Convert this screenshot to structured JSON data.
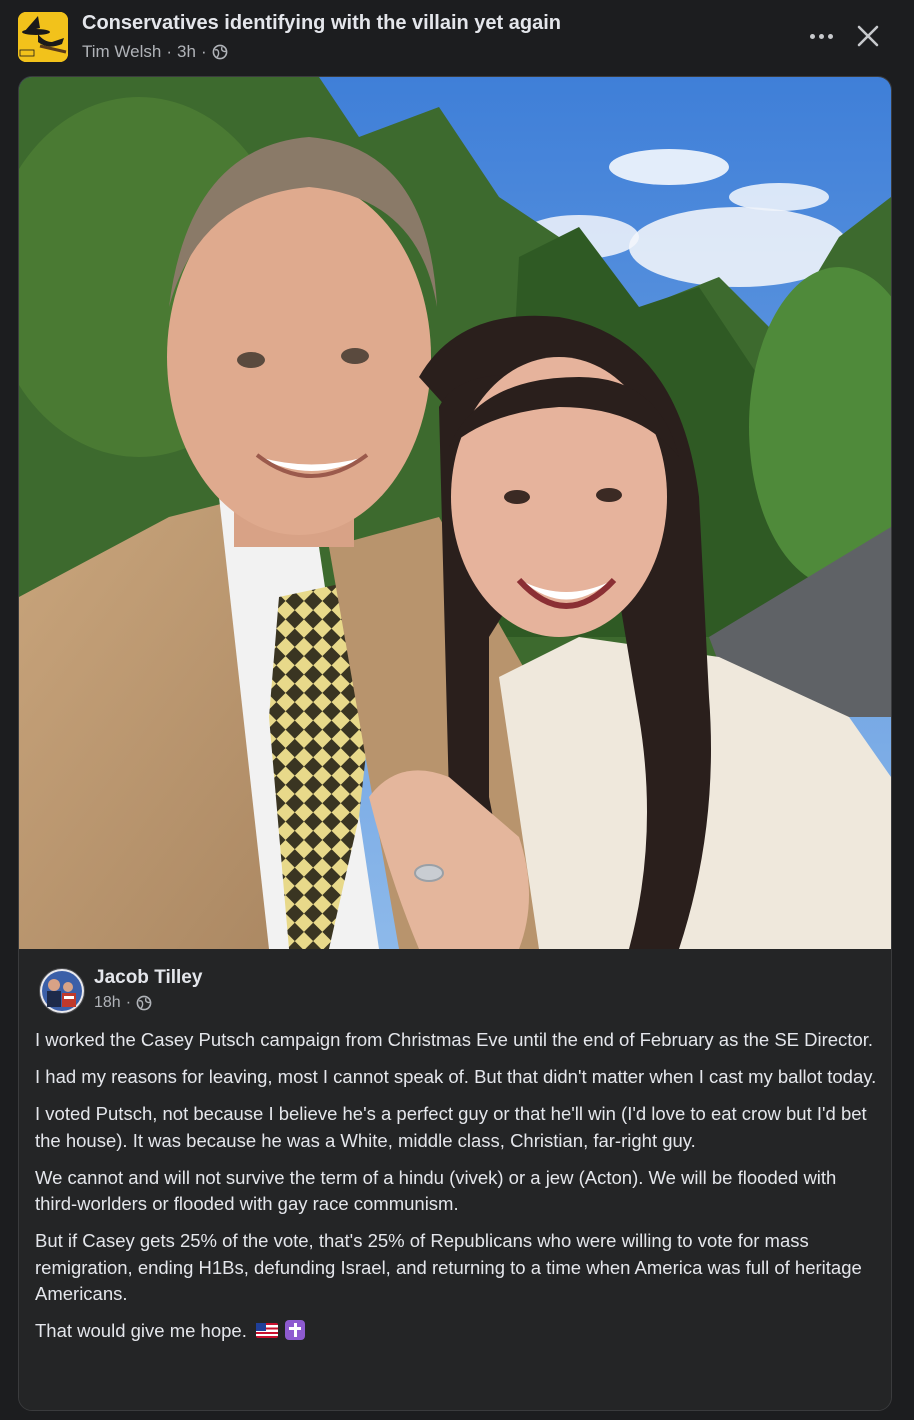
{
  "post": {
    "title": "Conservatives identifying with the villain yet again",
    "author": "Tim Welsh",
    "time": "3h",
    "separator": "·",
    "audience_icon": "globe-icon",
    "more_icon": "more-options-icon",
    "close_icon": "close-icon"
  },
  "shared_post": {
    "author": "Jacob Tilley",
    "time": "18h",
    "separator": "·",
    "audience_icon": "globe-icon",
    "paragraphs": [
      "I worked the Casey Putsch campaign from Christmas Eve until the end of February as the SE Director.",
      "I had my reasons for leaving, most I cannot speak of. But that didn't matter when I cast my ballot today.",
      "I voted Putsch, not because I believe he's a perfect guy or that he'll win (I'd love to eat crow but I'd bet the house). It was because he was a White, middle class, Christian, far-right guy.",
      "We cannot and will not survive the term of a hindu (vivek) or a jew (Acton). We will be flooded with third-worlders or flooded with gay race communism.",
      "But if Casey gets 25% of the vote, that's 25% of Republicans who were willing to vote for mass remigration, ending H1Bs, defunding Israel, and returning to a time when America was full of heritage Americans."
    ],
    "closing_line": "That would give me hope.",
    "closing_emojis": [
      "us-flag-emoji",
      "latin-cross-emoji"
    ]
  },
  "colors": {
    "background": "#1c1d1f",
    "card": "#242526",
    "text_primary": "#e4e6eb",
    "text_secondary": "#b0b3b8",
    "group_avatar": "#f2c21b"
  }
}
